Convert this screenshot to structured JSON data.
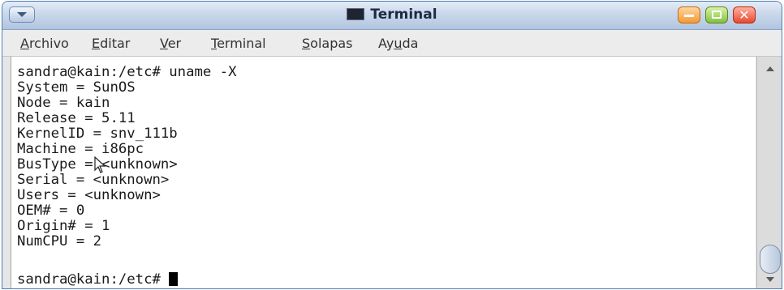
{
  "window": {
    "title": "Terminal"
  },
  "menubar": {
    "items": [
      {
        "pre": "",
        "key": "A",
        "post": "rchivo"
      },
      {
        "pre": "",
        "key": "E",
        "post": "ditar"
      },
      {
        "pre": "",
        "key": "V",
        "post": "er"
      },
      {
        "pre": "",
        "key": "T",
        "post": "erminal"
      },
      {
        "pre": "",
        "key": "S",
        "post": "olapas"
      },
      {
        "pre": "Ay",
        "key": "u",
        "post": "da"
      }
    ]
  },
  "terminal": {
    "lines": [
      "sandra@kain:/etc# uname -X",
      "System = SunOS",
      "Node = kain",
      "Release = 5.11",
      "KernelID = snv_111b",
      "Machine = i86pc",
      "BusType = <unknown>",
      "Serial = <unknown>",
      "Users = <unknown>",
      "OEM# = 0",
      "Origin# = 1",
      "NumCPU = 2",
      ""
    ],
    "prompt": "sandra@kain:/etc# "
  },
  "colors": {
    "titlebar": "#c9d7ea",
    "minimize": "#f29a33",
    "maximize": "#84bf3d",
    "close": "#e84a2f"
  },
  "icons": {
    "window_menu": "chevron-down-icon",
    "title": "terminal-icon",
    "minimize": "minimize-icon",
    "maximize": "maximize-icon",
    "close": "close-icon",
    "pointer": "mouse-pointer-icon",
    "scroll_up": "scroll-up-icon",
    "scroll_down": "scroll-down-icon"
  }
}
